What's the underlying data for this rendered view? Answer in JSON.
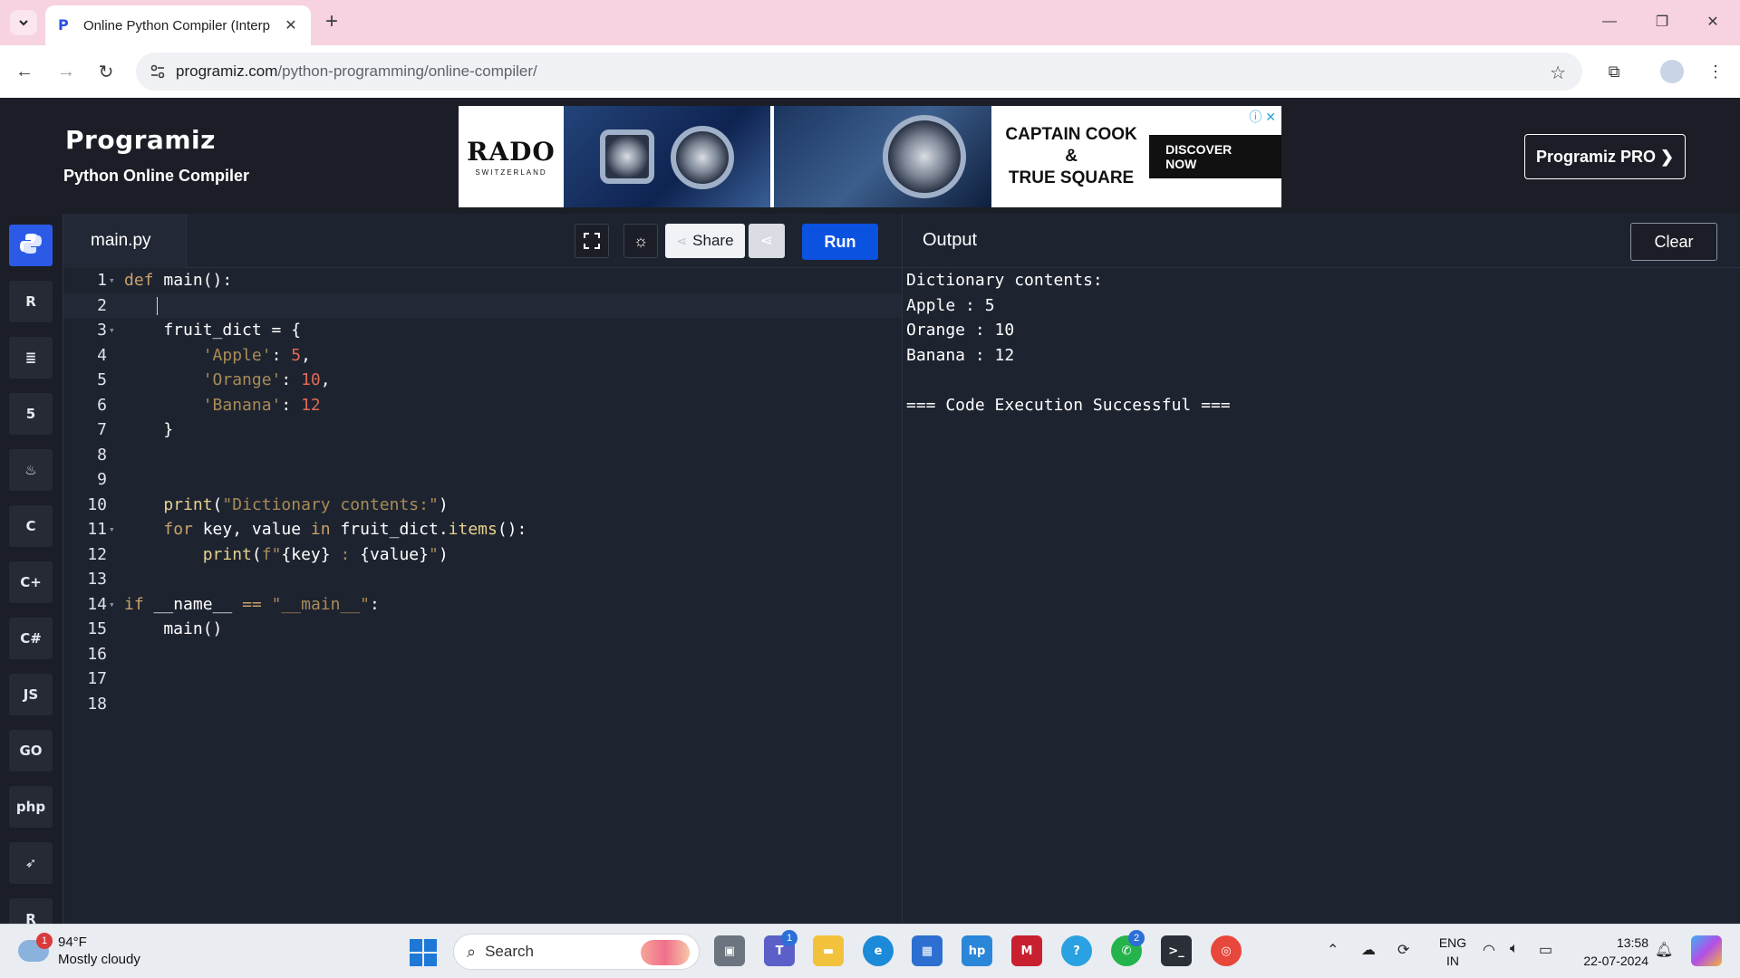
{
  "browser": {
    "tab_title": "Online Python Compiler (Interp",
    "url_domain": "programiz.com",
    "url_path": "/python-programming/online-compiler/"
  },
  "header": {
    "logo": "Programiz",
    "subtitle": "Python Online Compiler",
    "pro_button": "Programiz PRO ❯",
    "ad": {
      "brand": "RADO",
      "brand_sub": "SWITZERLAND",
      "headline_line1": "CAPTAIN COOK &",
      "headline_line2": "TRUE SQUARE",
      "cta": "DISCOVER NOW"
    }
  },
  "sidebar": {
    "languages": [
      {
        "label": "",
        "icon": "python-icon",
        "active": true
      },
      {
        "label": "R",
        "icon": "r-icon"
      },
      {
        "label": "≣",
        "icon": "sql-icon"
      },
      {
        "label": "5",
        "icon": "html-icon"
      },
      {
        "label": "♨",
        "icon": "java-icon"
      },
      {
        "label": "C",
        "icon": "c-icon"
      },
      {
        "label": "C+",
        "icon": "cpp-icon"
      },
      {
        "label": "C#",
        "icon": "csharp-icon"
      },
      {
        "label": "JS",
        "icon": "javascript-icon"
      },
      {
        "label": "GO",
        "icon": "go-icon"
      },
      {
        "label": "php",
        "icon": "php-icon"
      },
      {
        "label": "➶",
        "icon": "swift-icon"
      },
      {
        "label": "R",
        "icon": "rust-icon"
      }
    ]
  },
  "editor": {
    "file_name": "main.py",
    "share_label": "Share",
    "run_label": "Run",
    "lines": [
      {
        "n": "1",
        "fold": true,
        "tokens": [
          {
            "t": "def ",
            "c": "kw"
          },
          {
            "t": "main():",
            "c": "plain"
          }
        ]
      },
      {
        "n": "2",
        "active": true,
        "tokens": []
      },
      {
        "n": "3",
        "fold": true,
        "tokens": [
          {
            "t": "    fruit_dict = {",
            "c": "plain"
          }
        ]
      },
      {
        "n": "4",
        "tokens": [
          {
            "t": "        ",
            "c": "plain"
          },
          {
            "t": "'Apple'",
            "c": "str"
          },
          {
            "t": ": ",
            "c": "plain"
          },
          {
            "t": "5",
            "c": "num"
          },
          {
            "t": ",",
            "c": "plain"
          }
        ]
      },
      {
        "n": "5",
        "tokens": [
          {
            "t": "        ",
            "c": "plain"
          },
          {
            "t": "'Orange'",
            "c": "str"
          },
          {
            "t": ": ",
            "c": "plain"
          },
          {
            "t": "10",
            "c": "num"
          },
          {
            "t": ",",
            "c": "plain"
          }
        ]
      },
      {
        "n": "6",
        "tokens": [
          {
            "t": "        ",
            "c": "plain"
          },
          {
            "t": "'Banana'",
            "c": "str"
          },
          {
            "t": ": ",
            "c": "plain"
          },
          {
            "t": "12",
            "c": "num"
          }
        ]
      },
      {
        "n": "7",
        "tokens": [
          {
            "t": "    }",
            "c": "plain"
          }
        ]
      },
      {
        "n": "8",
        "tokens": []
      },
      {
        "n": "9",
        "tokens": []
      },
      {
        "n": "10",
        "tokens": [
          {
            "t": "    ",
            "c": "plain"
          },
          {
            "t": "print",
            "c": "fn"
          },
          {
            "t": "(",
            "c": "plain"
          },
          {
            "t": "\"Dictionary contents:\"",
            "c": "str"
          },
          {
            "t": ")",
            "c": "plain"
          }
        ]
      },
      {
        "n": "11",
        "fold": true,
        "tokens": [
          {
            "t": "    ",
            "c": "plain"
          },
          {
            "t": "for",
            "c": "kw"
          },
          {
            "t": " key, value ",
            "c": "plain"
          },
          {
            "t": "in",
            "c": "kw"
          },
          {
            "t": " fruit_dict.",
            "c": "plain"
          },
          {
            "t": "items",
            "c": "fn"
          },
          {
            "t": "():",
            "c": "plain"
          }
        ]
      },
      {
        "n": "12",
        "tokens": [
          {
            "t": "        ",
            "c": "plain"
          },
          {
            "t": "print",
            "c": "fn"
          },
          {
            "t": "(",
            "c": "plain"
          },
          {
            "t": "f\"",
            "c": "str"
          },
          {
            "t": "{key}",
            "c": "plain"
          },
          {
            "t": " : ",
            "c": "str"
          },
          {
            "t": "{value}",
            "c": "plain"
          },
          {
            "t": "\"",
            "c": "str"
          },
          {
            "t": ")",
            "c": "plain"
          }
        ]
      },
      {
        "n": "13",
        "tokens": []
      },
      {
        "n": "14",
        "fold": true,
        "tokens": [
          {
            "t": "if",
            "c": "kw"
          },
          {
            "t": " __name__ ",
            "c": "plain"
          },
          {
            "t": "==",
            "c": "kw"
          },
          {
            "t": " ",
            "c": "plain"
          },
          {
            "t": "\"__main__\"",
            "c": "str"
          },
          {
            "t": ":",
            "c": "plain"
          }
        ]
      },
      {
        "n": "15",
        "tokens": [
          {
            "t": "    main()",
            "c": "plain"
          }
        ]
      },
      {
        "n": "16",
        "tokens": []
      },
      {
        "n": "17",
        "tokens": []
      },
      {
        "n": "18",
        "tokens": []
      }
    ]
  },
  "output": {
    "title": "Output",
    "clear_label": "Clear",
    "lines": [
      "Dictionary contents:",
      "Apple : 5",
      "Orange : 10",
      "Banana : 12",
      "",
      "=== Code Execution Successful ==="
    ]
  },
  "taskbar": {
    "weather_temp": "94°F",
    "weather_desc": "Mostly cloudy",
    "weather_badge": "1",
    "search_placeholder": "Search",
    "teams_badge": "1",
    "whatsapp_badge": "2",
    "lang_line1": "ENG",
    "lang_line2": "IN",
    "time": "13:58",
    "date": "22-07-2024"
  }
}
